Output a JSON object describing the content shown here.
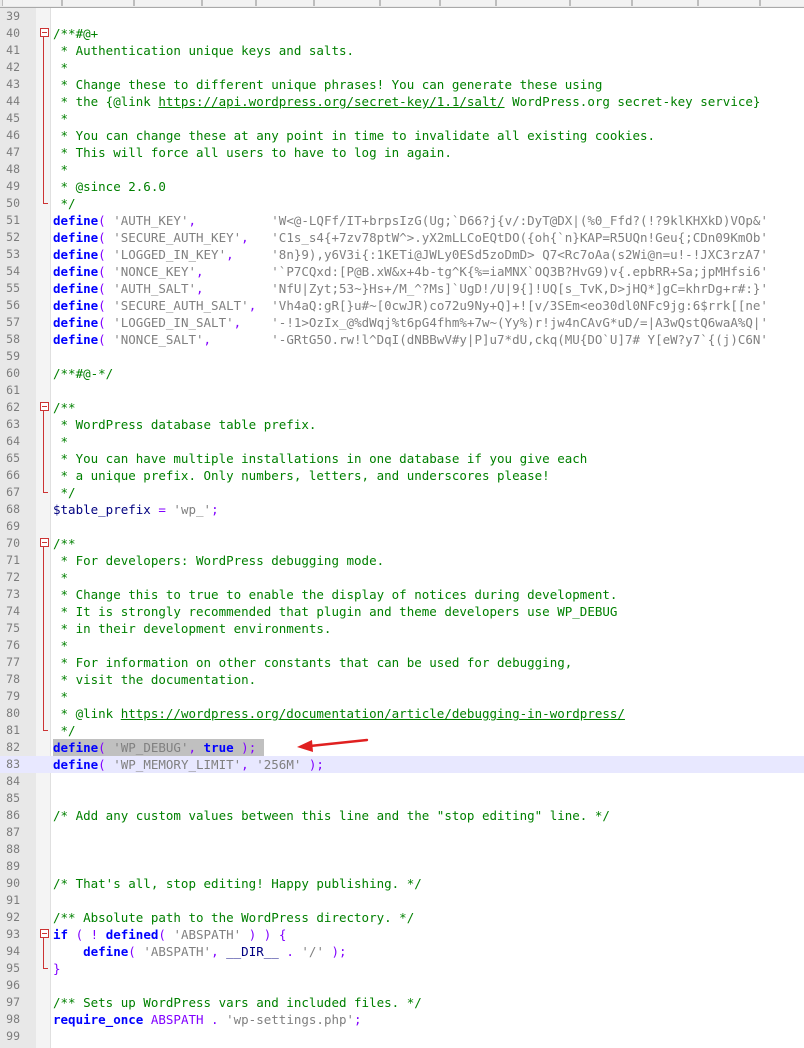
{
  "lines": [
    {
      "n": "39",
      "parts": []
    },
    {
      "n": "40",
      "fold": "open",
      "parts": [
        {
          "t": "/**#@+",
          "c": "c"
        }
      ]
    },
    {
      "n": "41",
      "fold": "bar",
      "parts": [
        {
          "t": " * Authentication unique keys and salts.",
          "c": "c"
        }
      ]
    },
    {
      "n": "42",
      "fold": "bar",
      "parts": [
        {
          "t": " *",
          "c": "c"
        }
      ]
    },
    {
      "n": "43",
      "fold": "bar",
      "parts": [
        {
          "t": " * Change these to different unique phrases! You can generate these using",
          "c": "c"
        }
      ]
    },
    {
      "n": "44",
      "fold": "bar",
      "parts": [
        {
          "t": " * the {@link ",
          "c": "c"
        },
        {
          "t": "https://api.wordpress.org/secret-key/1.1/salt/",
          "c": "lk"
        },
        {
          "t": " WordPress.org secret-key service}",
          "c": "c"
        }
      ]
    },
    {
      "n": "45",
      "fold": "bar",
      "parts": [
        {
          "t": " *",
          "c": "c"
        }
      ]
    },
    {
      "n": "46",
      "fold": "bar",
      "parts": [
        {
          "t": " * You can change these at any point in time to invalidate all existing cookies.",
          "c": "c"
        }
      ]
    },
    {
      "n": "47",
      "fold": "bar",
      "parts": [
        {
          "t": " * This will force all users to have to log in again.",
          "c": "c"
        }
      ]
    },
    {
      "n": "48",
      "fold": "bar",
      "parts": [
        {
          "t": " *",
          "c": "c"
        }
      ]
    },
    {
      "n": "49",
      "fold": "bar",
      "parts": [
        {
          "t": " * @since 2.6.0",
          "c": "c"
        }
      ]
    },
    {
      "n": "50",
      "fold": "end",
      "parts": [
        {
          "t": " */",
          "c": "c"
        }
      ]
    },
    {
      "n": "51",
      "parts": [
        {
          "t": "define",
          "c": "k"
        },
        {
          "t": "( ",
          "c": "o"
        },
        {
          "t": "'AUTH_KEY'",
          "c": "s"
        },
        {
          "t": ",          ",
          "c": "o"
        },
        {
          "t": "'W<@-LQFf/IT+brpsIzG(Ug;`D66?j{v/:DyT@DX|(%0_Ffd?(!?9klKHXkD)VOp&'",
          "c": "s"
        }
      ]
    },
    {
      "n": "52",
      "parts": [
        {
          "t": "define",
          "c": "k"
        },
        {
          "t": "( ",
          "c": "o"
        },
        {
          "t": "'SECURE_AUTH_KEY'",
          "c": "s"
        },
        {
          "t": ",   ",
          "c": "o"
        },
        {
          "t": "'C1s_s4{+7zv78ptW^>.yX2mLLCoEQtDO({oh{`n}KAP=R5UQn!Geu{;CDn09KmOb'",
          "c": "s"
        }
      ]
    },
    {
      "n": "53",
      "parts": [
        {
          "t": "define",
          "c": "k"
        },
        {
          "t": "( ",
          "c": "o"
        },
        {
          "t": "'LOGGED_IN_KEY'",
          "c": "s"
        },
        {
          "t": ",     ",
          "c": "o"
        },
        {
          "t": "'8n}9),y6V3i{:1KETi@JWLy0ESd5zoDmD> Q7<Rc7oAa(s2Wi@n=u!-!JXC3rzA7'",
          "c": "s"
        }
      ]
    },
    {
      "n": "54",
      "parts": [
        {
          "t": "define",
          "c": "k"
        },
        {
          "t": "( ",
          "c": "o"
        },
        {
          "t": "'NONCE_KEY'",
          "c": "s"
        },
        {
          "t": ",         ",
          "c": "o"
        },
        {
          "t": "'`P7CQxd:[P@B.xW&x+4b-tg^K{%=iaMNX`OQ3B?HvG9)v{.epbRR+Sa;jpMHfsi6'",
          "c": "s"
        }
      ]
    },
    {
      "n": "55",
      "parts": [
        {
          "t": "define",
          "c": "k"
        },
        {
          "t": "( ",
          "c": "o"
        },
        {
          "t": "'AUTH_SALT'",
          "c": "s"
        },
        {
          "t": ",         ",
          "c": "o"
        },
        {
          "t": "'NfU|Zyt;53~}Hs+/M_^?Ms]`UgD!/U|9{]!UQ[s_TvK,D>jHQ*]gC=khrDg+r#:}'",
          "c": "s"
        }
      ]
    },
    {
      "n": "56",
      "parts": [
        {
          "t": "define",
          "c": "k"
        },
        {
          "t": "( ",
          "c": "o"
        },
        {
          "t": "'SECURE_AUTH_SALT'",
          "c": "s"
        },
        {
          "t": ",  ",
          "c": "o"
        },
        {
          "t": "'Vh4aQ:gR[}u#~[0cwJR)co72u9Ny+Q]+![v/3SEm<eo30dl0NFc9jg:6$rrk[[ne'",
          "c": "s"
        }
      ]
    },
    {
      "n": "57",
      "parts": [
        {
          "t": "define",
          "c": "k"
        },
        {
          "t": "( ",
          "c": "o"
        },
        {
          "t": "'LOGGED_IN_SALT'",
          "c": "s"
        },
        {
          "t": ",    ",
          "c": "o"
        },
        {
          "t": "'-!1>OzIx_@%dWqj%t6pG4fhm%+7w~(Yy%)r!jw4nCAvG*uD/=|A3wQstQ6waA%Q|'",
          "c": "s"
        }
      ]
    },
    {
      "n": "58",
      "parts": [
        {
          "t": "define",
          "c": "k"
        },
        {
          "t": "( ",
          "c": "o"
        },
        {
          "t": "'NONCE_SALT'",
          "c": "s"
        },
        {
          "t": ",        ",
          "c": "o"
        },
        {
          "t": "'-GRtG5O.rw!l^DqI(dNBBwV#y|P]u7*dU,ckq(MU{DO`U]7# Y[eW?y7`{(j)C6N'",
          "c": "s"
        }
      ]
    },
    {
      "n": "59",
      "parts": []
    },
    {
      "n": "60",
      "parts": [
        {
          "t": "/**#@-*/",
          "c": "c"
        }
      ]
    },
    {
      "n": "61",
      "parts": []
    },
    {
      "n": "62",
      "fold": "open",
      "parts": [
        {
          "t": "/**",
          "c": "c"
        }
      ]
    },
    {
      "n": "63",
      "fold": "bar",
      "parts": [
        {
          "t": " * WordPress database table prefix.",
          "c": "c"
        }
      ]
    },
    {
      "n": "64",
      "fold": "bar",
      "parts": [
        {
          "t": " *",
          "c": "c"
        }
      ]
    },
    {
      "n": "65",
      "fold": "bar",
      "parts": [
        {
          "t": " * You can have multiple installations in one database if you give each",
          "c": "c"
        }
      ]
    },
    {
      "n": "66",
      "fold": "bar",
      "parts": [
        {
          "t": " * a unique prefix. Only numbers, letters, and underscores please!",
          "c": "c"
        }
      ]
    },
    {
      "n": "67",
      "fold": "end",
      "parts": [
        {
          "t": " */",
          "c": "c"
        }
      ]
    },
    {
      "n": "68",
      "parts": [
        {
          "t": "$table_prefix",
          "c": "v"
        },
        {
          "t": " = ",
          "c": "o"
        },
        {
          "t": "'wp_'",
          "c": "s"
        },
        {
          "t": ";",
          "c": "o"
        }
      ]
    },
    {
      "n": "69",
      "parts": []
    },
    {
      "n": "70",
      "fold": "open",
      "parts": [
        {
          "t": "/**",
          "c": "c"
        }
      ]
    },
    {
      "n": "71",
      "fold": "bar",
      "parts": [
        {
          "t": " * For developers: WordPress debugging mode.",
          "c": "c"
        }
      ]
    },
    {
      "n": "72",
      "fold": "bar",
      "parts": [
        {
          "t": " *",
          "c": "c"
        }
      ]
    },
    {
      "n": "73",
      "fold": "bar",
      "parts": [
        {
          "t": " * Change this to true to enable the display of notices during development.",
          "c": "c"
        }
      ]
    },
    {
      "n": "74",
      "fold": "bar",
      "parts": [
        {
          "t": " * It is strongly recommended that plugin and theme developers use WP_DEBUG",
          "c": "c"
        }
      ]
    },
    {
      "n": "75",
      "fold": "bar",
      "parts": [
        {
          "t": " * in their development environments.",
          "c": "c"
        }
      ]
    },
    {
      "n": "76",
      "fold": "bar",
      "parts": [
        {
          "t": " *",
          "c": "c"
        }
      ]
    },
    {
      "n": "77",
      "fold": "bar",
      "parts": [
        {
          "t": " * For information on other constants that can be used for debugging,",
          "c": "c"
        }
      ]
    },
    {
      "n": "78",
      "fold": "bar",
      "parts": [
        {
          "t": " * visit the documentation.",
          "c": "c"
        }
      ]
    },
    {
      "n": "79",
      "fold": "bar",
      "parts": [
        {
          "t": " *",
          "c": "c"
        }
      ]
    },
    {
      "n": "80",
      "fold": "bar",
      "parts": [
        {
          "t": " * @link ",
          "c": "c"
        },
        {
          "t": "https://wordpress.org/documentation/article/debugging-in-wordpress/",
          "c": "lk"
        }
      ]
    },
    {
      "n": "81",
      "fold": "end",
      "parts": [
        {
          "t": " */",
          "c": "c"
        }
      ]
    },
    {
      "n": "82",
      "sel": true,
      "parts": [
        {
          "t": "define",
          "c": "k"
        },
        {
          "t": "( ",
          "c": "o"
        },
        {
          "t": "'WP_DEBUG'",
          "c": "s"
        },
        {
          "t": ", ",
          "c": "o"
        },
        {
          "t": "true",
          "c": "k"
        },
        {
          "t": " ); ",
          "c": "o"
        }
      ]
    },
    {
      "n": "83",
      "caret": true,
      "parts": [
        {
          "t": "define",
          "c": "k"
        },
        {
          "t": "( ",
          "c": "o"
        },
        {
          "t": "'WP_MEMORY_LIMIT'",
          "c": "s"
        },
        {
          "t": ", ",
          "c": "o"
        },
        {
          "t": "'256M'",
          "c": "s"
        },
        {
          "t": " );",
          "c": "o"
        }
      ]
    },
    {
      "n": "84",
      "parts": []
    },
    {
      "n": "85",
      "parts": []
    },
    {
      "n": "86",
      "parts": [
        {
          "t": "/* Add any custom values between this line and the \"stop editing\" line. */",
          "c": "c"
        }
      ]
    },
    {
      "n": "87",
      "parts": []
    },
    {
      "n": "88",
      "parts": []
    },
    {
      "n": "89",
      "parts": []
    },
    {
      "n": "90",
      "parts": [
        {
          "t": "/* That's all, stop editing! Happy publishing. */",
          "c": "c"
        }
      ]
    },
    {
      "n": "91",
      "parts": []
    },
    {
      "n": "92",
      "parts": [
        {
          "t": "/** Absolute path to the WordPress directory. */",
          "c": "c"
        }
      ]
    },
    {
      "n": "93",
      "fold": "open",
      "parts": [
        {
          "t": "if",
          "c": "k"
        },
        {
          "t": " ( ! ",
          "c": "o"
        },
        {
          "t": "defined",
          "c": "k"
        },
        {
          "t": "( ",
          "c": "o"
        },
        {
          "t": "'ABSPATH'",
          "c": "s"
        },
        {
          "t": " ) ) {",
          "c": "o"
        }
      ]
    },
    {
      "n": "94",
      "fold": "bar",
      "parts": [
        {
          "t": "    ",
          "c": "o"
        },
        {
          "t": "define",
          "c": "k"
        },
        {
          "t": "( ",
          "c": "o"
        },
        {
          "t": "'ABSPATH'",
          "c": "s"
        },
        {
          "t": ", ",
          "c": "o"
        },
        {
          "t": "__DIR__",
          "c": "v"
        },
        {
          "t": " . ",
          "c": "o"
        },
        {
          "t": "'/'",
          "c": "s"
        },
        {
          "t": " );",
          "c": "o"
        }
      ]
    },
    {
      "n": "95",
      "fold": "end",
      "parts": [
        {
          "t": "}",
          "c": "o"
        }
      ]
    },
    {
      "n": "96",
      "parts": []
    },
    {
      "n": "97",
      "parts": [
        {
          "t": "/** Sets up WordPress vars and included files. */",
          "c": "c"
        }
      ]
    },
    {
      "n": "98",
      "parts": [
        {
          "t": "require_once",
          "c": "k"
        },
        {
          "t": " ABSPATH . ",
          "c": "o"
        },
        {
          "t": "'wp-settings.php'",
          "c": "s"
        },
        {
          "t": ";",
          "c": "o"
        }
      ]
    },
    {
      "n": "99",
      "parts": []
    }
  ],
  "annotation": {
    "icon": "red-arrow-icon",
    "color": "#e02020"
  }
}
